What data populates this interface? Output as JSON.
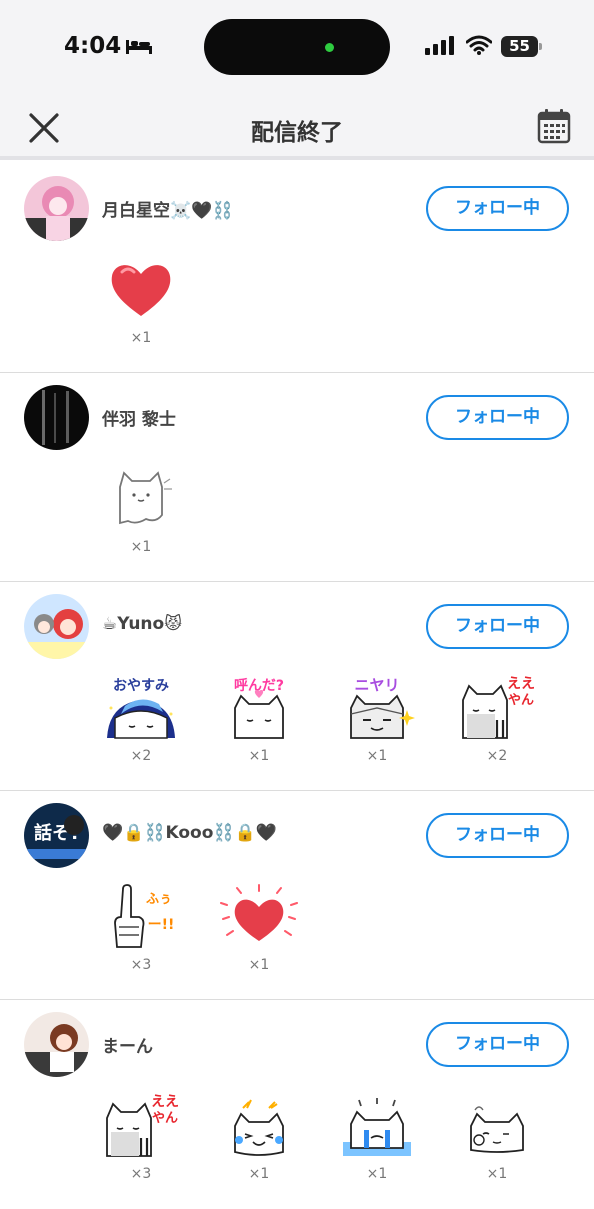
{
  "status_bar": {
    "time": "4:04",
    "battery": "55"
  },
  "header": {
    "title": "配信終了"
  },
  "users": [
    {
      "name": "月白星空☠️🖤⛓️",
      "follow_label": "フォロー中",
      "gifts": [
        {
          "icon": "heart-sticker-icon",
          "count": "×1"
        }
      ]
    },
    {
      "name": "伴羽 黎士",
      "follow_label": "フォロー中",
      "gifts": [
        {
          "icon": "cat-ghost-sticker-icon",
          "count": "×1"
        }
      ]
    },
    {
      "name": "☕Yuno😾",
      "follow_label": "フォロー中",
      "gifts": [
        {
          "icon": "oyasumi-cat-sticker-icon",
          "text": "おやすみ",
          "count": "×2"
        },
        {
          "icon": "yonda-cat-sticker-icon",
          "text": "呼んだ?",
          "count": "×1"
        },
        {
          "icon": "niyari-cat-sticker-icon",
          "text": "ニヤリ",
          "count": "×1"
        },
        {
          "icon": "eeyan-cat-sticker-icon",
          "text": "ええやん",
          "count": "×2"
        }
      ]
    },
    {
      "name": "🖤🔒⛓️Kooo⛓️🔒🖤",
      "follow_label": "フォロー中",
      "gifts": [
        {
          "icon": "fuu-finger-sticker-icon",
          "text": "ふぅー!!",
          "count": "×3"
        },
        {
          "icon": "sparkle-heart-sticker-icon",
          "count": "×1"
        }
      ]
    },
    {
      "name": "まーん",
      "follow_label": "フォロー中",
      "gifts": [
        {
          "icon": "eeyan-cat-sticker-icon",
          "text": "ええやん",
          "count": "×3"
        },
        {
          "icon": "laughing-cat-sticker-icon",
          "count": "×1"
        },
        {
          "icon": "crying-cat-sticker-icon",
          "count": "×1"
        },
        {
          "icon": "blushing-cat-sticker-icon",
          "count": "×1"
        }
      ]
    }
  ]
}
